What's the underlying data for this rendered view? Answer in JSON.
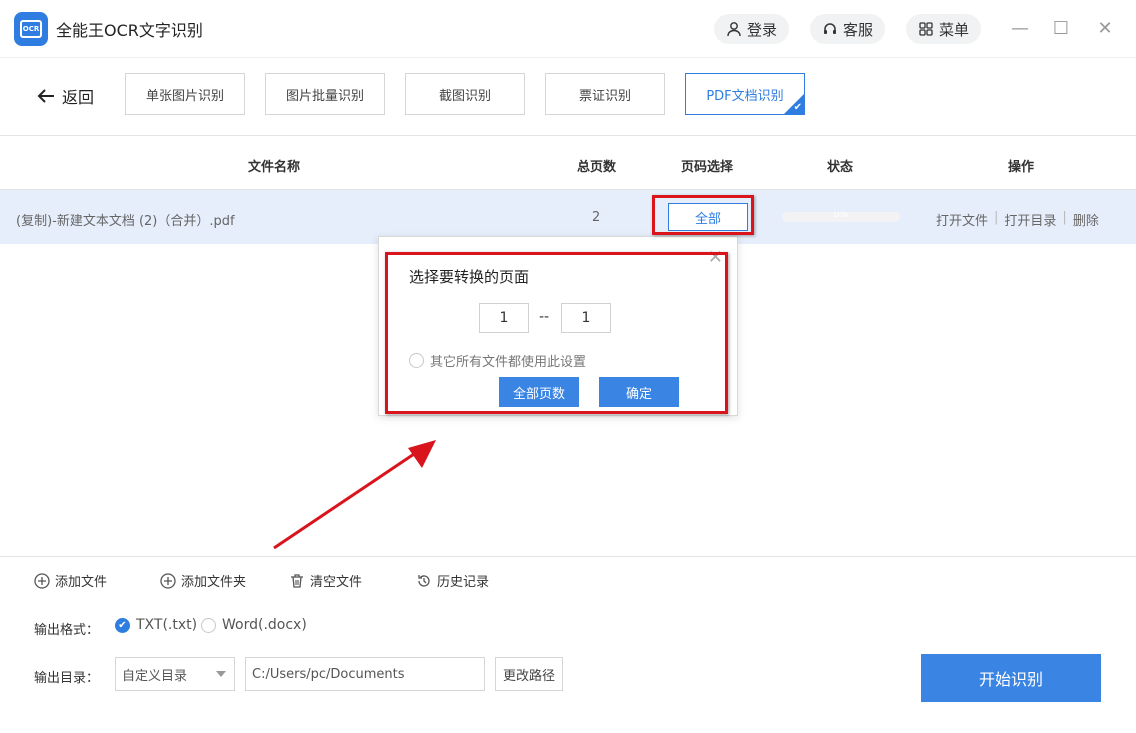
{
  "app": {
    "title": "全能王OCR文字识别",
    "logo_text": "OCR"
  },
  "header": {
    "login": "登录",
    "service": "客服",
    "menu": "菜单"
  },
  "window": {
    "minimize": "—",
    "maximize": "☐",
    "close": "✕"
  },
  "toolbar": {
    "back": "返回",
    "tabs": [
      {
        "label": "单张图片识别"
      },
      {
        "label": "图片批量识别"
      },
      {
        "label": "截图识别"
      },
      {
        "label": "票证识别"
      },
      {
        "label": "PDF文档识别"
      }
    ]
  },
  "table": {
    "headers": {
      "name": "文件名称",
      "pages": "总页数",
      "page_select": "页码选择",
      "status": "状态",
      "ops": "操作"
    },
    "rows": [
      {
        "name": "(复制)-新建文本文档 (2)（合并）.pdf",
        "pages": "2",
        "page_select": "全部",
        "progress": "0%",
        "progress_value": 0,
        "op_open_file": "打开文件",
        "op_open_dir": "打开目录",
        "op_delete": "删除"
      }
    ]
  },
  "dialog": {
    "title": "选择要转换的页面",
    "from": "1",
    "to": "1",
    "separator": "--",
    "apply_all": "其它所有文件都使用此设置",
    "all_pages": "全部页数",
    "confirm": "确定",
    "close": "✕"
  },
  "bottom": {
    "add_file": "添加文件",
    "add_folder": "添加文件夹",
    "clear": "清空文件",
    "history": "历史记录",
    "format_label": "输出格式：",
    "format_txt": "TXT(.txt)",
    "format_word": "Word(.docx)",
    "dir_label": "输出目录：",
    "dir_select": "自定义目录",
    "dir_path": "C:/Users/pc/Documents",
    "change_path": "更改路径",
    "start": "开始识别"
  },
  "colors": {
    "accent": "#2f7de1",
    "highlight": "#d9141d",
    "row_bg": "#e6eefb"
  }
}
